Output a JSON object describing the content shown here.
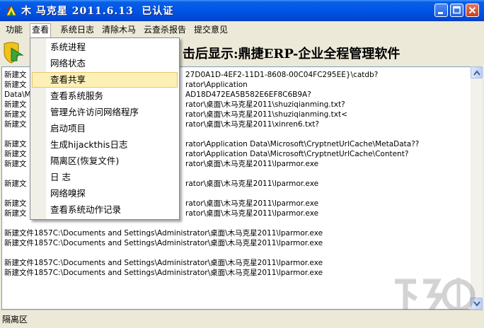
{
  "window": {
    "title": "木 马克星 2011.6.13  已认证"
  },
  "menubar": {
    "items": [
      "功能",
      "查看",
      "系统日志",
      "清除木马",
      "云查杀报告",
      "提交意见"
    ]
  },
  "banner": {
    "text": "击后显示:鼎捷ERP-企业全程管理软件"
  },
  "view_menu": {
    "items": [
      "系统进程",
      "网络状态",
      "查看共享",
      "查看系统服务",
      "管理允许访问网络程序",
      "启动项目",
      "生成hijackthis日志",
      "隔离区(恢复文件)",
      "日  志",
      "网络嗅探",
      "查看系统动作记录"
    ],
    "highlighted": "查看共享"
  },
  "log": {
    "lines": [
      {
        "left": "新建文",
        "right": "27D0A1D-4EF2-11D1-8608-00C04FC295EE}\\catdb?"
      },
      {
        "left": "新建文",
        "right": "rator\\Application"
      },
      {
        "left": "Data\\Mi",
        "right": "AD18D472EA5B582E6EF8C6B9A?"
      },
      {
        "left": "新建文",
        "right": "rator\\桌面\\木马克星2011\\shuziqianming.txt?"
      },
      {
        "left": "新建文",
        "right": "rator\\桌面\\木马克星2011\\shuziqianming.txt<"
      },
      {
        "left": "新建文",
        "right": "rator\\桌面\\木马克星2011\\xinren6.txt?"
      },
      {
        "left": "",
        "right": ""
      },
      {
        "left": "新建文",
        "right": "rator\\Application Data\\Microsoft\\CryptnetUrlCache\\MetaData??"
      },
      {
        "left": "新建文",
        "right": "rator\\Application Data\\Microsoft\\CryptnetUrlCache\\Content?"
      },
      {
        "left": "新建文",
        "right": "rator\\桌面\\木马克星2011\\lparmor.exe"
      },
      {
        "left": "",
        "right": ""
      },
      {
        "left": "新建文",
        "right": "rator\\桌面\\木马克星2011\\lparmor.exe"
      },
      {
        "left": "",
        "right": ""
      },
      {
        "left": "新建文",
        "right": "rator\\桌面\\木马克星2011\\lparmor.exe"
      },
      {
        "left": "新建文",
        "right": "rator\\桌面\\木马克星2011\\lparmor.exe"
      },
      {
        "left": "",
        "right": ""
      },
      {
        "left": "新建文件1857C:\\Documents and Settings\\Administrator\\桌面\\木马克星2011\\lparmor.exe",
        "right": ""
      },
      {
        "left": "新建文件1857C:\\Documents and Settings\\Administrator\\桌面\\木马克星2011\\lparmor.exe",
        "right": ""
      },
      {
        "left": "",
        "right": ""
      },
      {
        "left": "新建文件1857C:\\Documents and Settings\\Administrator\\桌面\\木马克星2011\\lparmor.exe",
        "right": ""
      },
      {
        "left": "新建文件1857C:\\Documents and Settings\\Administrator\\桌面\\木马克星2011\\lparmor.exe",
        "right": ""
      }
    ]
  },
  "statusbar": {
    "text": "隔离区"
  }
}
